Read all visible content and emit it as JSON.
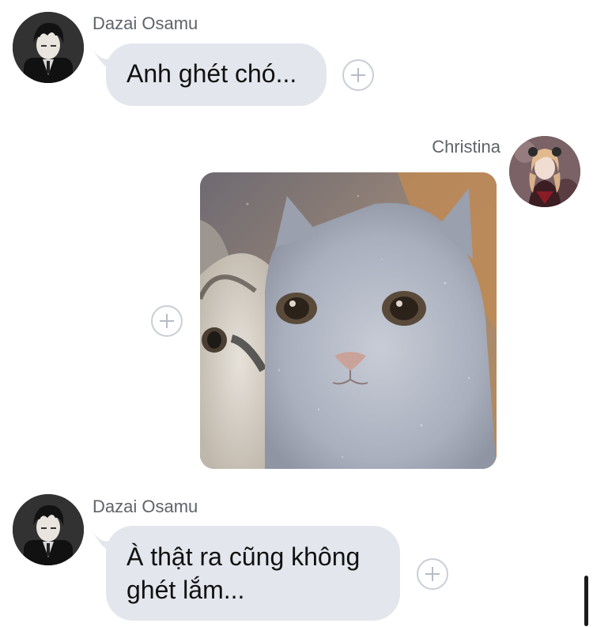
{
  "messages": [
    {
      "sender": "Dazai Osamu",
      "text": "Anh ghét chó...",
      "react_icon": "plus-icon"
    },
    {
      "sender": "Christina",
      "attachment_icon": "photo-cat-meme",
      "react_icon": "plus-icon"
    },
    {
      "sender": "Dazai Osamu",
      "line1": "À thật ra cũng không",
      "line2": "ghét lắm...",
      "react_icon": "plus-icon"
    }
  ],
  "colors": {
    "bubble": "#e3e7ed",
    "sender_name": "#5f6368",
    "text": "#111111",
    "react_border": "#c9ced6",
    "scrollbar": "#1c1c1c"
  }
}
